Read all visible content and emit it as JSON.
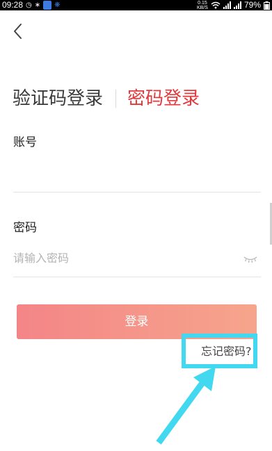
{
  "status_bar": {
    "time": "09:28",
    "net_speed_value": "0.15",
    "net_speed_unit": "KB/S",
    "battery": "79%",
    "icons": [
      "alarm-icon",
      "bluetooth-icon",
      "shield-app-icon",
      "app-notification-icon",
      "wifi-icon",
      "signal-icon",
      "battery-icon"
    ]
  },
  "header": {
    "back_icon": "chevron-left-icon"
  },
  "tabs": {
    "code_login": "验证码登录",
    "password_login": "密码登录",
    "active": "password_login",
    "active_color": "#e5383b"
  },
  "form": {
    "account_label": "账号",
    "account_value": "",
    "password_label": "密码",
    "password_placeholder": "请输入密码",
    "password_toggle_icon": "eye-closed-icon"
  },
  "actions": {
    "login_label": "登录",
    "forgot_password": "忘记密码?"
  },
  "annotation": {
    "highlight_color": "#41d8f0"
  }
}
